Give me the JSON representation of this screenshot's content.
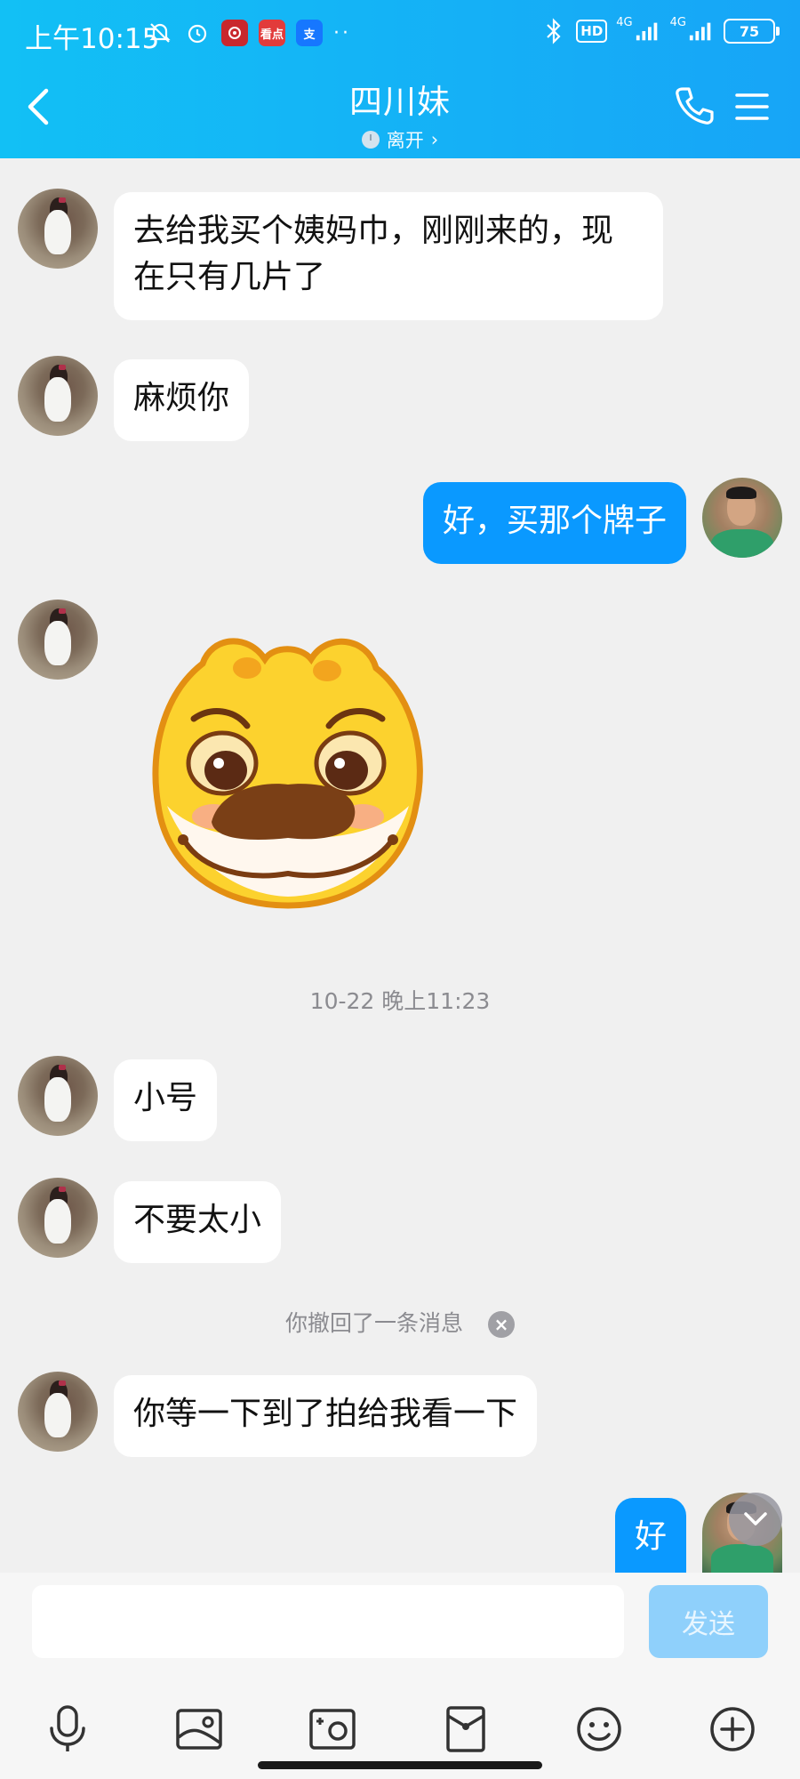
{
  "status_bar": {
    "time": "上午10:15",
    "app_icons": [
      {
        "name": "netease-music-icon",
        "color": "#c9282d"
      },
      {
        "name": "kandian-icon",
        "label": "看点",
        "color": "#e23b3b"
      },
      {
        "name": "alipay-icon",
        "label": "支",
        "color": "#1677ff"
      }
    ],
    "hd": "HD",
    "network": [
      "4G",
      "4G"
    ],
    "battery": "75"
  },
  "header": {
    "title": "四川妹",
    "presence": "离开",
    "colors": {
      "start": "#12c0f5",
      "end": "#17a5f7"
    }
  },
  "messages": [
    {
      "from": "her",
      "type": "text",
      "lines": [
        "去给我买个姨妈巾，刚刚来的，现",
        "在只有几片了"
      ]
    },
    {
      "from": "her",
      "type": "text",
      "text": "麻烦你"
    },
    {
      "from": "me",
      "type": "text",
      "text": "好，买那个牌子"
    },
    {
      "from": "her",
      "type": "sticker",
      "sticker": "shy-dog-sticker"
    },
    {
      "type": "timestamp",
      "text": "10-22 晚上11:23"
    },
    {
      "from": "her",
      "type": "text",
      "text": "小号"
    },
    {
      "from": "her",
      "type": "text",
      "text": "不要太小"
    },
    {
      "type": "recall",
      "text": "你撤回了一条消息"
    },
    {
      "from": "her",
      "type": "text",
      "text": "你等一下到了拍给我看一下"
    },
    {
      "from": "me",
      "type": "text",
      "text": "好"
    }
  ],
  "input": {
    "value": "",
    "placeholder": "",
    "send_label": "发送"
  },
  "toolbar": [
    "mic-icon",
    "image-icon",
    "camera-icon",
    "red-packet-icon",
    "emoji-icon",
    "plus-icon"
  ],
  "colors": {
    "bubble_out": "#0a99ff",
    "bubble_in": "#ffffff",
    "background": "#f0f0f0"
  }
}
